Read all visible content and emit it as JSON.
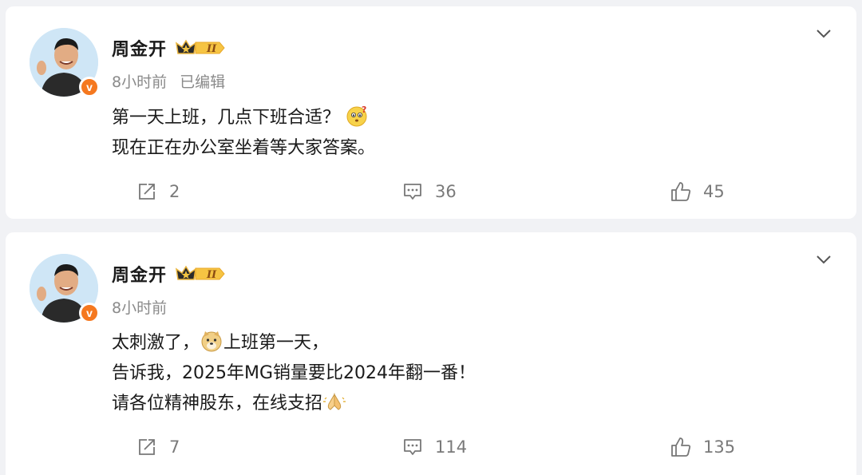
{
  "posts": [
    {
      "author": "周金开",
      "time": "8小时前",
      "edited": "已编辑",
      "lines": [
        "第一天上班，几点下班合适？",
        "现在正在办公室坐着等大家答案。"
      ],
      "emoji": "thinking-face-icon",
      "repost_count": "2",
      "comment_count": "36",
      "like_count": "45"
    },
    {
      "author": "周金开",
      "time": "8小时前",
      "line1_a": "太刺激了，",
      "line1_b": "上班第一天，",
      "line2": "告诉我，2025年MG销量要比2024年翻一番！",
      "line3": "请各位精神股东，在线支招",
      "repost_count": "7",
      "comment_count": "114",
      "like_count": "135"
    }
  ],
  "colors": {
    "badge": "#f5781f",
    "muted": "#8a8a8a",
    "text": "#1a1a1a"
  }
}
